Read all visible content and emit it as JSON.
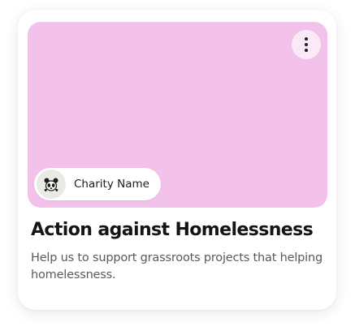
{
  "card": {
    "hero_color": "#f3c2ea",
    "menu_icon": "more-vertical-icon",
    "charity": {
      "logo_icon": "panda-logo-icon",
      "name": "Charity Name"
    },
    "title": "Action against Homelessness",
    "description": "Help us to support grassroots projects that helping homelessness."
  }
}
